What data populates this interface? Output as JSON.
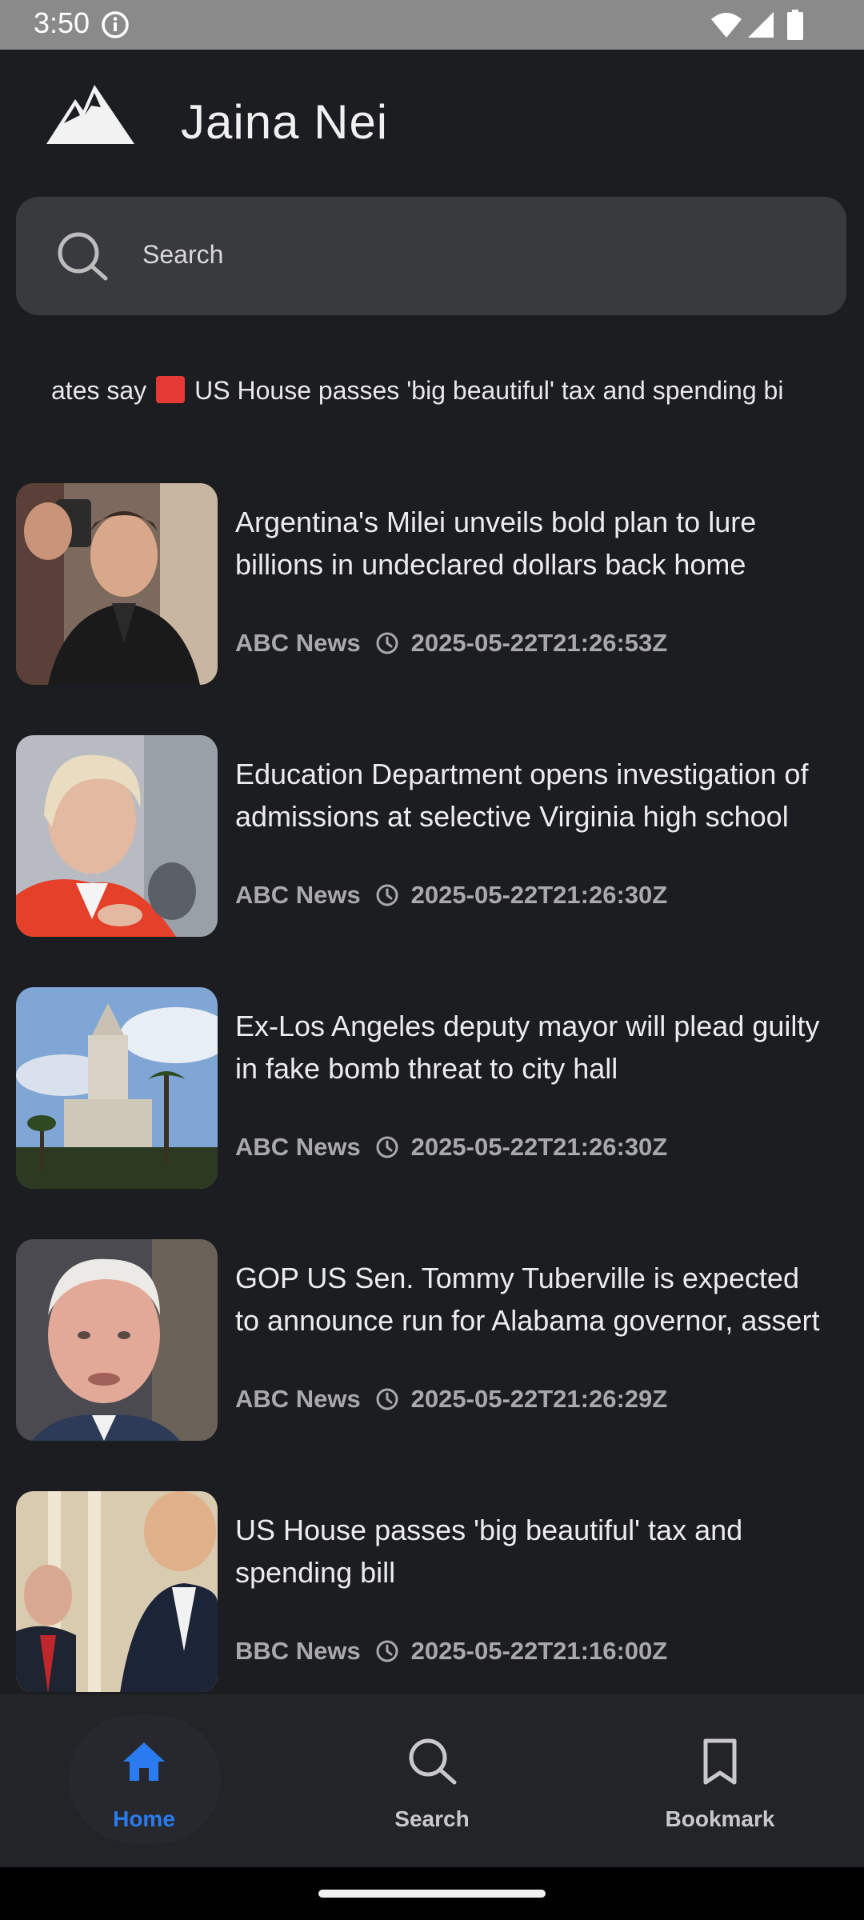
{
  "status_bar": {
    "time": "3:50"
  },
  "app": {
    "title": "Jaina Nei"
  },
  "search": {
    "placeholder": "Search"
  },
  "ticker": {
    "text_before": "ates say",
    "text_after": "US House passes 'big beautiful' tax and spending bi"
  },
  "news": {
    "items": [
      {
        "headline": "Argentina's Milei unveils bold plan to lure billions in undeclared dollars back home",
        "source": "ABC News",
        "timestamp": "2025-05-22T21:26:53Z"
      },
      {
        "headline": "Education Department opens investigation of admissions at selective Virginia high school",
        "source": "ABC News",
        "timestamp": "2025-05-22T21:26:30Z"
      },
      {
        "headline": "Ex-Los Angeles deputy mayor will plead guilty in fake bomb threat to city hall",
        "source": "ABC News",
        "timestamp": "2025-05-22T21:26:30Z"
      },
      {
        "headline": "GOP US Sen. Tommy Tuberville is expected to announce run for Alabama governor, assert",
        "source": "ABC News",
        "timestamp": "2025-05-22T21:26:29Z"
      },
      {
        "headline": "US House passes 'big beautiful' tax and spending bill",
        "source": "BBC News",
        "timestamp": "2025-05-22T21:16:00Z"
      }
    ]
  },
  "bottom_nav": {
    "items": [
      {
        "label": "Home",
        "icon": "home-icon",
        "active": true
      },
      {
        "label": "Search",
        "icon": "search-icon",
        "active": false
      },
      {
        "label": "Bookmark",
        "icon": "bookmark-icon",
        "active": false
      }
    ]
  },
  "colors": {
    "background": "#1c1d21",
    "accent": "#2b7bf0",
    "search_bg": "#393a3e",
    "flag_red": "#e53935"
  }
}
